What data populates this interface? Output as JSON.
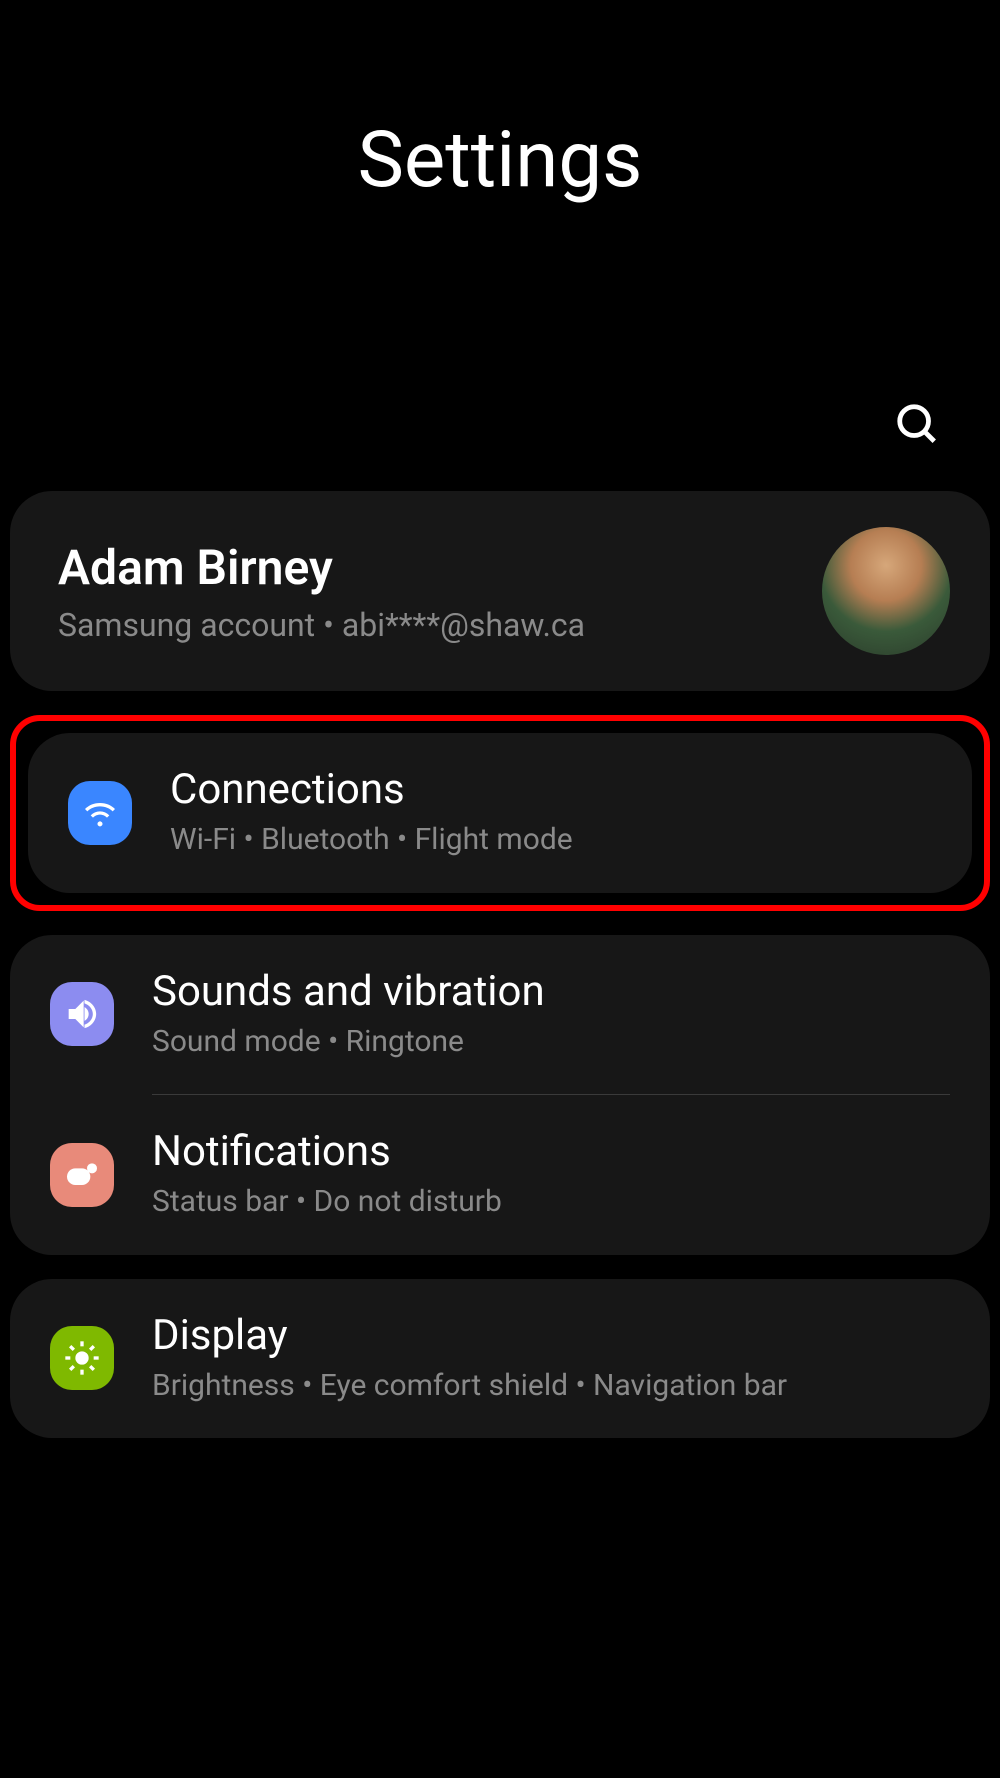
{
  "header": {
    "title": "Settings"
  },
  "account": {
    "name": "Adam Birney",
    "sub": "Samsung account  •  abi****@shaw.ca"
  },
  "groups": [
    {
      "highlighted": true,
      "items": [
        {
          "key": "connections",
          "title": "Connections",
          "sub": "Wi-Fi  •  Bluetooth  •  Flight mode",
          "color": "blue",
          "icon": "wifi"
        }
      ]
    },
    {
      "highlighted": false,
      "items": [
        {
          "key": "sounds",
          "title": "Sounds and vibration",
          "sub": "Sound mode  •  Ringtone",
          "color": "purple",
          "icon": "sound"
        },
        {
          "key": "notifications",
          "title": "Notifications",
          "sub": "Status bar  •  Do not disturb",
          "color": "salmon",
          "icon": "notif"
        }
      ]
    },
    {
      "highlighted": false,
      "items": [
        {
          "key": "display",
          "title": "Display",
          "sub": "Brightness  •  Eye comfort shield  •  Navigation bar",
          "color": "green",
          "icon": "display"
        }
      ]
    }
  ]
}
